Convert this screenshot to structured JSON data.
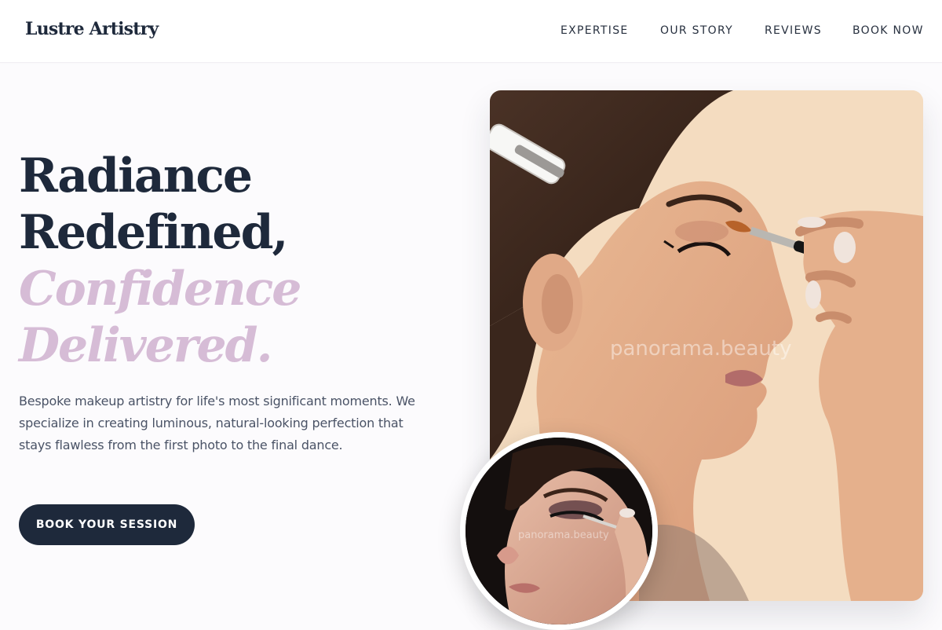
{
  "brand": {
    "logo": "Lustre Artistry"
  },
  "nav": {
    "items": [
      {
        "label": "EXPERTISE"
      },
      {
        "label": "OUR STORY"
      },
      {
        "label": "REVIEWS"
      },
      {
        "label": "BOOK NOW"
      }
    ]
  },
  "hero": {
    "headline_line1": "Radiance",
    "headline_line2": "Redefined,",
    "headline_italic_line1": "Confidence",
    "headline_italic_line2": "Delivered.",
    "description": "Bespoke makeup artistry for life's most significant moments. We specialize in creating luminous, natural-looking perfection that stays flawless from the first photo to the final dance.",
    "cta_label": "BOOK YOUR SESSION"
  },
  "images": {
    "main_watermark": "panorama.beauty",
    "inset_watermark": "panorama.beauty"
  },
  "colors": {
    "navy": "#1e293b",
    "accent_lilac": "#d6bcd6",
    "page_bg": "#fcfbfd"
  }
}
